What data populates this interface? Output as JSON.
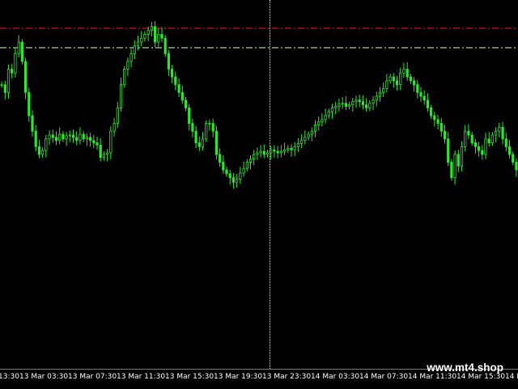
{
  "watermark": "www.mt4.shop",
  "colors": {
    "background": "#000000",
    "candle": "#2ee62e",
    "resistance_line": "#d01414",
    "support_line": "#9bd68e",
    "crosshair": "#d8d8d8",
    "axis_text": "#ffffff"
  },
  "time_axis": {
    "labels": [
      "13 Mar 03:30",
      "13 Mar 07:30",
      "13 Mar 11:30",
      "13 Mar 15:30",
      "13 Mar 19:30",
      "13 Mar 23:30",
      "14 Mar 03:30",
      "14 Mar 07:30",
      "14 Mar 11:30",
      "14 Mar 15:30"
    ],
    "edge_left": "13:30",
    "edge_right": "14 M"
  },
  "chart_data": {
    "type": "candlestick",
    "price_closes_relative": [
      160,
      150,
      180,
      175,
      200,
      215,
      190,
      150,
      120,
      100,
      80,
      70,
      75,
      90,
      95,
      92,
      88,
      96,
      90,
      94,
      95,
      92,
      88,
      96,
      90,
      92,
      88,
      85,
      82,
      66,
      70,
      72,
      100,
      110,
      130,
      160,
      180,
      190,
      200,
      210,
      215,
      220,
      225,
      230,
      235,
      215,
      225,
      220,
      200,
      180,
      170,
      160,
      150,
      140,
      130,
      110,
      100,
      85,
      80,
      90,
      110,
      110,
      100,
      70,
      60,
      50,
      45,
      40,
      34,
      38,
      46,
      52,
      60,
      64,
      70,
      72,
      74,
      70,
      72,
      76,
      74,
      72,
      74,
      76,
      78,
      76,
      80,
      84,
      88,
      92,
      96,
      100,
      108,
      112,
      115,
      120,
      125,
      130,
      132,
      135,
      136,
      132,
      134,
      138,
      140,
      138,
      134,
      130,
      136,
      140,
      145,
      150,
      155,
      165,
      170,
      165,
      160,
      175,
      180,
      170,
      165,
      160,
      150,
      145,
      140,
      130,
      120,
      115,
      110,
      100,
      90,
      60,
      40,
      70,
      55,
      80,
      100,
      95,
      85,
      80,
      75,
      70,
      90,
      85,
      95,
      100,
      105,
      90,
      80,
      70,
      60,
      50
    ]
  },
  "levels": {
    "resistance": "dash-dot red",
    "support": "dash-dot light green"
  }
}
